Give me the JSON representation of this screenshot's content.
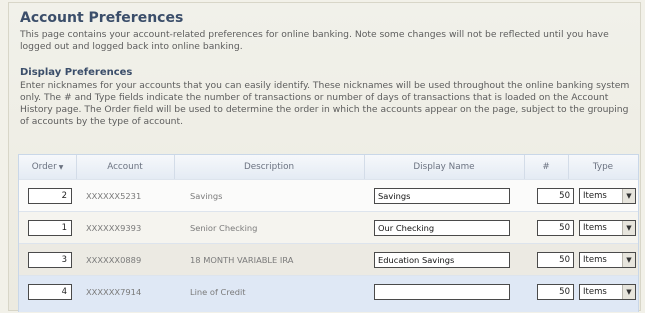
{
  "page": {
    "title": "Account Preferences",
    "intro": "This page contains your account-related preferences for online banking. Note some changes will not be reflected until you have logged out and logged back into online banking.",
    "section_title": "Display Preferences",
    "section_desc": "Enter nicknames for your accounts that you can easily identify. These nicknames will be used throughout the online banking system only. The # and Type fields indicate the number of transactions or number of days of transactions that is loaded on the Account History page. The Order field will be used to determine the order in which the accounts appear on the page, subject to the grouping of accounts by the type of account."
  },
  "table": {
    "columns": {
      "order": "Order",
      "sort_icon": "sort-descending-icon",
      "account": "Account",
      "description": "Description",
      "display_name": "Display Name",
      "number": "#",
      "type": "Type"
    },
    "rows": [
      {
        "order": "2",
        "account": "XXXXXX5231",
        "description": "Savings",
        "display_name": "Savings",
        "number": "50",
        "type": "Items"
      },
      {
        "order": "1",
        "account": "XXXXXX9393",
        "description": "Senior Checking",
        "display_name": "Our Checking",
        "number": "50",
        "type": "Items"
      },
      {
        "order": "3",
        "account": "XXXXXX0889",
        "description": "18 MONTH VARIABLE IRA",
        "display_name": "Education Savings",
        "number": "50",
        "type": "Items"
      },
      {
        "order": "4",
        "account": "XXXXXX7914",
        "description": "Line of Credit",
        "display_name": "",
        "number": "50",
        "type": "Items"
      }
    ]
  }
}
